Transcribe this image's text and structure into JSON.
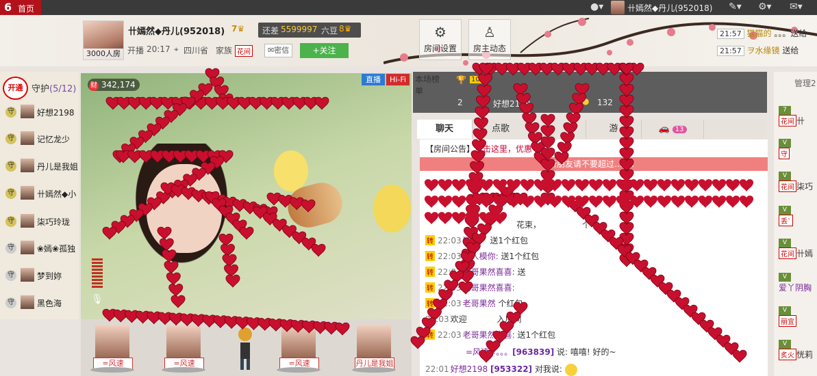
{
  "topbar": {
    "logo": "6",
    "home": "首页",
    "user": "卄嫣然◆丹儿(952018)"
  },
  "anchor": {
    "name": "卄嫣然◆丹儿(952018)",
    "level": "7",
    "room_count": "3000人房",
    "gap_label": "还差",
    "gap_value": "5599997",
    "gap_unit": "六豆",
    "start_label": "开播",
    "start_time": "20:17",
    "location": "四川省",
    "family_label": "家族",
    "family_tag": "花间",
    "secret": "密信",
    "follow": "+关注"
  },
  "buttons": {
    "room_settings": "房间设置",
    "host_dynamics": "房主动态"
  },
  "notices": [
    {
      "time": "21:57",
      "name": "猫猫的",
      "text": "。。。送给"
    },
    {
      "time": "21:57",
      "name": "ヲ水缘镜",
      "text": "送给"
    }
  ],
  "guard": {
    "open": "开通",
    "title": "守护",
    "count": "(5/12)",
    "items": [
      {
        "badge": "守",
        "name": "好想2198"
      },
      {
        "badge": "守",
        "name": "记忆龙少"
      },
      {
        "badge": "守",
        "name": "丹儿是我姐"
      },
      {
        "badge": "守",
        "name": "卄嫣然◆小"
      },
      {
        "badge": "守",
        "name": "柒巧玲珑"
      },
      {
        "badge": "守",
        "name": "❀嫣❀孤独"
      },
      {
        "badge": "守",
        "name": "梦到妳"
      },
      {
        "badge": "守",
        "name": "黑色海"
      }
    ]
  },
  "video": {
    "wealth": "342,174",
    "wealth_icon": "财",
    "live": "直播",
    "hifi": "Hi-Fi"
  },
  "seats": [
    {
      "label": "=风速"
    },
    {
      "label": "=风速"
    },
    {
      "label": "=风速"
    },
    {
      "label": "丹儿是我姐"
    }
  ],
  "rank": {
    "tab": "本场榜单",
    "first_rank": "10",
    "second_pos": "2",
    "second_name": "好想2198",
    "second_value": "132"
  },
  "tabs": [
    "聊天",
    "点歌",
    "",
    "游",
    ""
  ],
  "car_count": "13",
  "announcement": {
    "label": "【房间公告】",
    "link": "点击这里，优惠"
  },
  "notice_bar": "新朋友请不要超过…哦！",
  "chat": [
    {
      "zhuan": "",
      "time": "",
      "user": "",
      "text": "花束，",
      "extra": "个"
    },
    {
      "zhuan": "转",
      "time": "22:03",
      "user": "猫",
      "text": "送1个红包"
    },
    {
      "zhuan": "转",
      "time": "22:03",
      "user": "猎人模你:",
      "text": "送1个红包"
    },
    {
      "zhuan": "转",
      "time": "22:03",
      "user": "老哥果然喜喜:",
      "text": "送"
    },
    {
      "zhuan": "转",
      "time": "22:03",
      "user": "老哥果然喜喜:",
      "text": ""
    },
    {
      "zhuan": "转",
      "time": "22:03",
      "user": "老哥果然",
      "text": "个红包"
    },
    {
      "zhuan": "",
      "time": "22:03",
      "user": "欢迎",
      "text": "入房间"
    },
    {
      "zhuan": "转",
      "time": "22:03",
      "user": "老哥果然喜喜:",
      "text": "送1个红包"
    },
    {
      "zhuan": "",
      "time": "",
      "user": "=风速=。。。",
      "id": "[963839]",
      "text": "说: 嘻嘻! 好的~"
    },
    {
      "zhuan": "",
      "time": "22:01",
      "user": "好想2198",
      "id": "[953322]",
      "text": "对我说:"
    }
  ],
  "userlist": {
    "title": "管理2",
    "rows": [
      {
        "tag": "花间",
        "name": "卄"
      },
      {
        "tag": "守",
        "name": ""
      },
      {
        "tag": "花间",
        "name": "柒巧"
      },
      {
        "tag": "丢`",
        "name": ""
      },
      {
        "tag": "花间",
        "name": "卄嫣"
      },
      {
        "tag": "",
        "name": "爱丫阴胸"
      },
      {
        "tag": "丽宜",
        "name": ""
      },
      {
        "tag": "炙火",
        "name": "恍莉"
      }
    ]
  },
  "colors": {
    "accent_red": "#b3121b",
    "follow_green": "#4cb24c",
    "heart_red": "#c8102e"
  }
}
